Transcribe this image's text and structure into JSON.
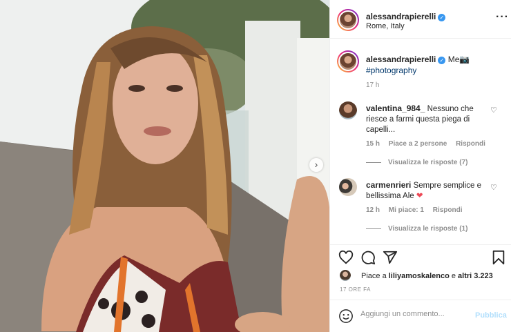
{
  "post": {
    "username": "alessandrapierelli",
    "location": "Rome, Italy",
    "caption_text": "Me📷",
    "caption_hashtag": "#photography",
    "time_ago": "17 h"
  },
  "comments": [
    {
      "username": "valentina_984_",
      "text": "Nessuno che riesce a farmi questa piega di capelli...",
      "time": "15 h",
      "likes": "Piace a 2 persone",
      "reply_label": "Rispondi",
      "view_replies": "Visualizza le risposte (7)"
    },
    {
      "username": "carmenrieri",
      "text": "Sempre semplice e bellissima Ale",
      "emoji": "❤",
      "time": "12 h",
      "likes": "Mi piace: 1",
      "reply_label": "Rispondi",
      "view_replies": "Visualizza le risposte (1)"
    }
  ],
  "likes": {
    "prefix": "Piace a ",
    "user": "liliyamoskalenco",
    "middle": " e ",
    "others": "altri 3.223"
  },
  "post_date": "17 ORE FA",
  "comment_box": {
    "placeholder": "Aggiungi un commento...",
    "publish_label": "Pubblica"
  },
  "icons": {
    "more": "more-options-icon",
    "heart": "heart-icon",
    "comment": "comment-icon",
    "share": "share-icon",
    "save": "bookmark-icon",
    "emoji": "emoji-icon",
    "verified": "verified-badge-icon",
    "next": "chevron-right-icon"
  },
  "colors": {
    "link": "#00376b",
    "muted": "#8e8e8e",
    "verified": "#3897f0",
    "publish_disabled": "#b2dffc",
    "heart_red": "#ed4956"
  }
}
